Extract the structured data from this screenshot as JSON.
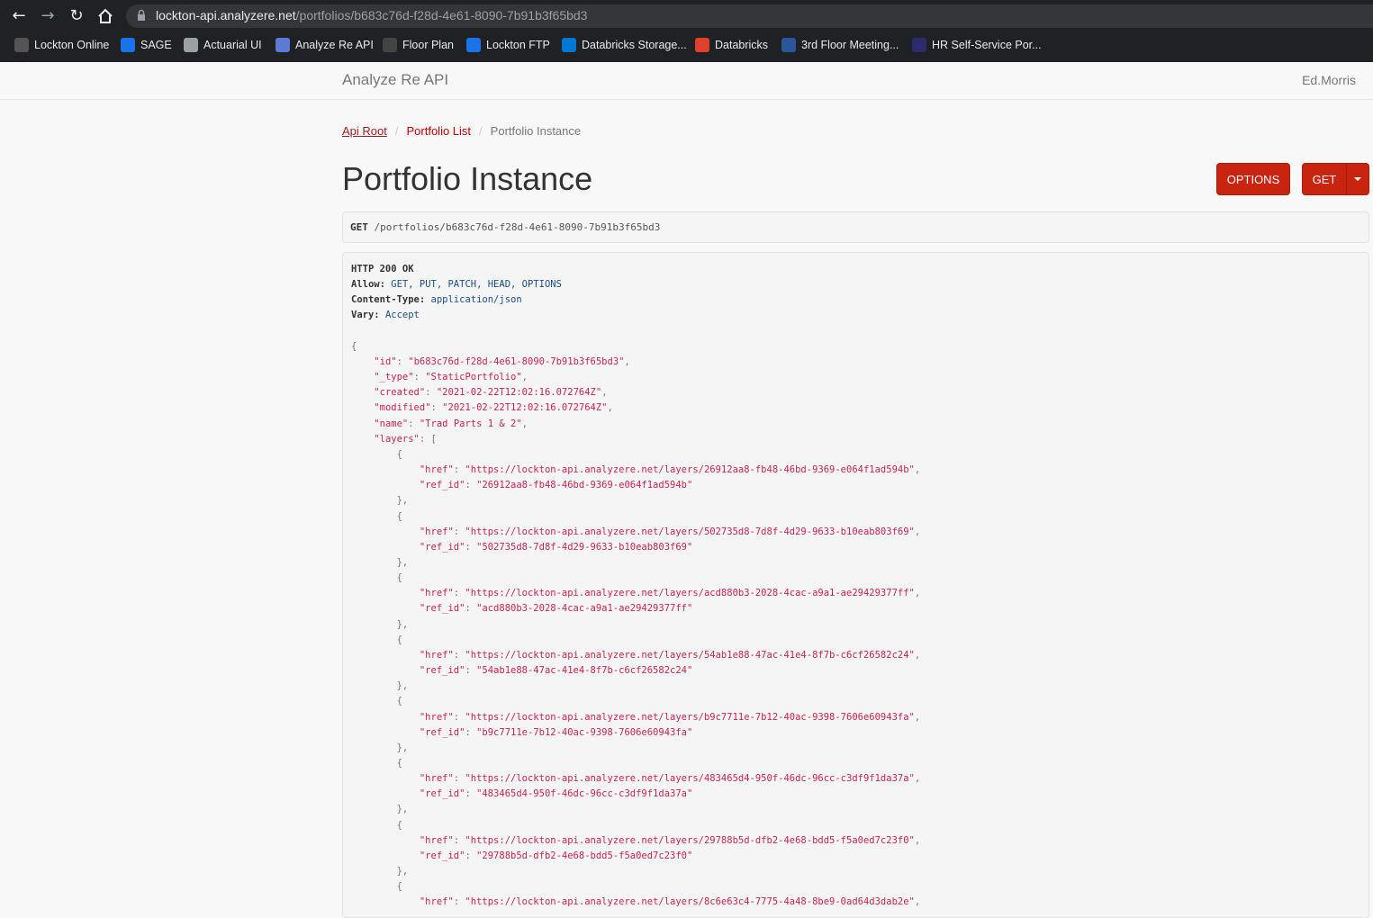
{
  "browser": {
    "url_host": "lockton-api.analyzere.net",
    "url_path": "/portfolios/b683c76d-f28d-4e61-8090-7b91b3f65bd3",
    "bookmarks": [
      {
        "label": "Lockton Online",
        "icon": "lockton-icon",
        "color": "#555555"
      },
      {
        "label": "SAGE",
        "icon": "sage-icon",
        "color": "#1a73e8"
      },
      {
        "label": "Actuarial UI",
        "icon": "globe-icon",
        "color": "#9aa0a6"
      },
      {
        "label": "Analyze Re API",
        "icon": "analyzere-icon",
        "color": "#5b7bd5"
      },
      {
        "label": "Floor Plan",
        "icon": "floorplan-icon",
        "color": "#444444"
      },
      {
        "label": "Lockton FTP",
        "icon": "ftp-icon",
        "color": "#1a73e8"
      },
      {
        "label": "Databricks Storage...",
        "icon": "azure-icon",
        "color": "#0078d4"
      },
      {
        "label": "Databricks",
        "icon": "databricks-icon",
        "color": "#e0402c"
      },
      {
        "label": "3rd Floor Meeting...",
        "icon": "word-icon",
        "color": "#2b579a"
      },
      {
        "label": "HR Self-Service Por...",
        "icon": "m-icon",
        "color": "#2b2b6e"
      }
    ]
  },
  "navbar": {
    "brand": "Analyze Re API",
    "user": "Ed.Morris"
  },
  "breadcrumb": {
    "root": "Api Root",
    "list": "Portfolio List",
    "current": "Portfolio Instance"
  },
  "page": {
    "title": "Portfolio Instance"
  },
  "buttons": {
    "options": "OPTIONS",
    "get": "GET"
  },
  "request": {
    "method": "GET",
    "path": "/portfolios/b683c76d-f28d-4e61-8090-7b91b3f65bd3"
  },
  "response": {
    "status": "HTTP 200 OK",
    "headers": [
      {
        "key": "Allow:",
        "value": "GET, PUT, PATCH, HEAD, OPTIONS"
      },
      {
        "key": "Content-Type:",
        "value": "application/json"
      },
      {
        "key": "Vary:",
        "value": "Accept"
      }
    ],
    "body": {
      "id": "b683c76d-f28d-4e61-8090-7b91b3f65bd3",
      "_type": "StaticPortfolio",
      "created": "2021-02-22T12:02:16.072764Z",
      "modified": "2021-02-22T12:02:16.072764Z",
      "name": "Trad Parts 1 & 2",
      "layers": [
        {
          "href": "https://lockton-api.analyzere.net/layers/26912aa8-fb48-46bd-9369-e064f1ad594b",
          "ref_id": "26912aa8-fb48-46bd-9369-e064f1ad594b"
        },
        {
          "href": "https://lockton-api.analyzere.net/layers/502735d8-7d8f-4d29-9633-b10eab803f69",
          "ref_id": "502735d8-7d8f-4d29-9633-b10eab803f69"
        },
        {
          "href": "https://lockton-api.analyzere.net/layers/acd880b3-2028-4cac-a9a1-ae29429377ff",
          "ref_id": "acd880b3-2028-4cac-a9a1-ae29429377ff"
        },
        {
          "href": "https://lockton-api.analyzere.net/layers/54ab1e88-47ac-41e4-8f7b-c6cf26582c24",
          "ref_id": "54ab1e88-47ac-41e4-8f7b-c6cf26582c24"
        },
        {
          "href": "https://lockton-api.analyzere.net/layers/b9c7711e-7b12-40ac-9398-7606e60943fa",
          "ref_id": "b9c7711e-7b12-40ac-9398-7606e60943fa"
        },
        {
          "href": "https://lockton-api.analyzere.net/layers/483465d4-950f-46dc-96cc-c3df9f1da37a",
          "ref_id": "483465d4-950f-46dc-96cc-c3df9f1da37a"
        },
        {
          "href": "https://lockton-api.analyzere.net/layers/29788b5d-dfb2-4e68-bdd5-f5a0ed7c23f0",
          "ref_id": "29788b5d-dfb2-4e68-bdd5-f5a0ed7c23f0"
        },
        {
          "href": "https://lockton-api.analyzere.net/layers/8c6e63c4-7775-4a48-8be9-0ad64d3dab2e"
        }
      ]
    }
  }
}
